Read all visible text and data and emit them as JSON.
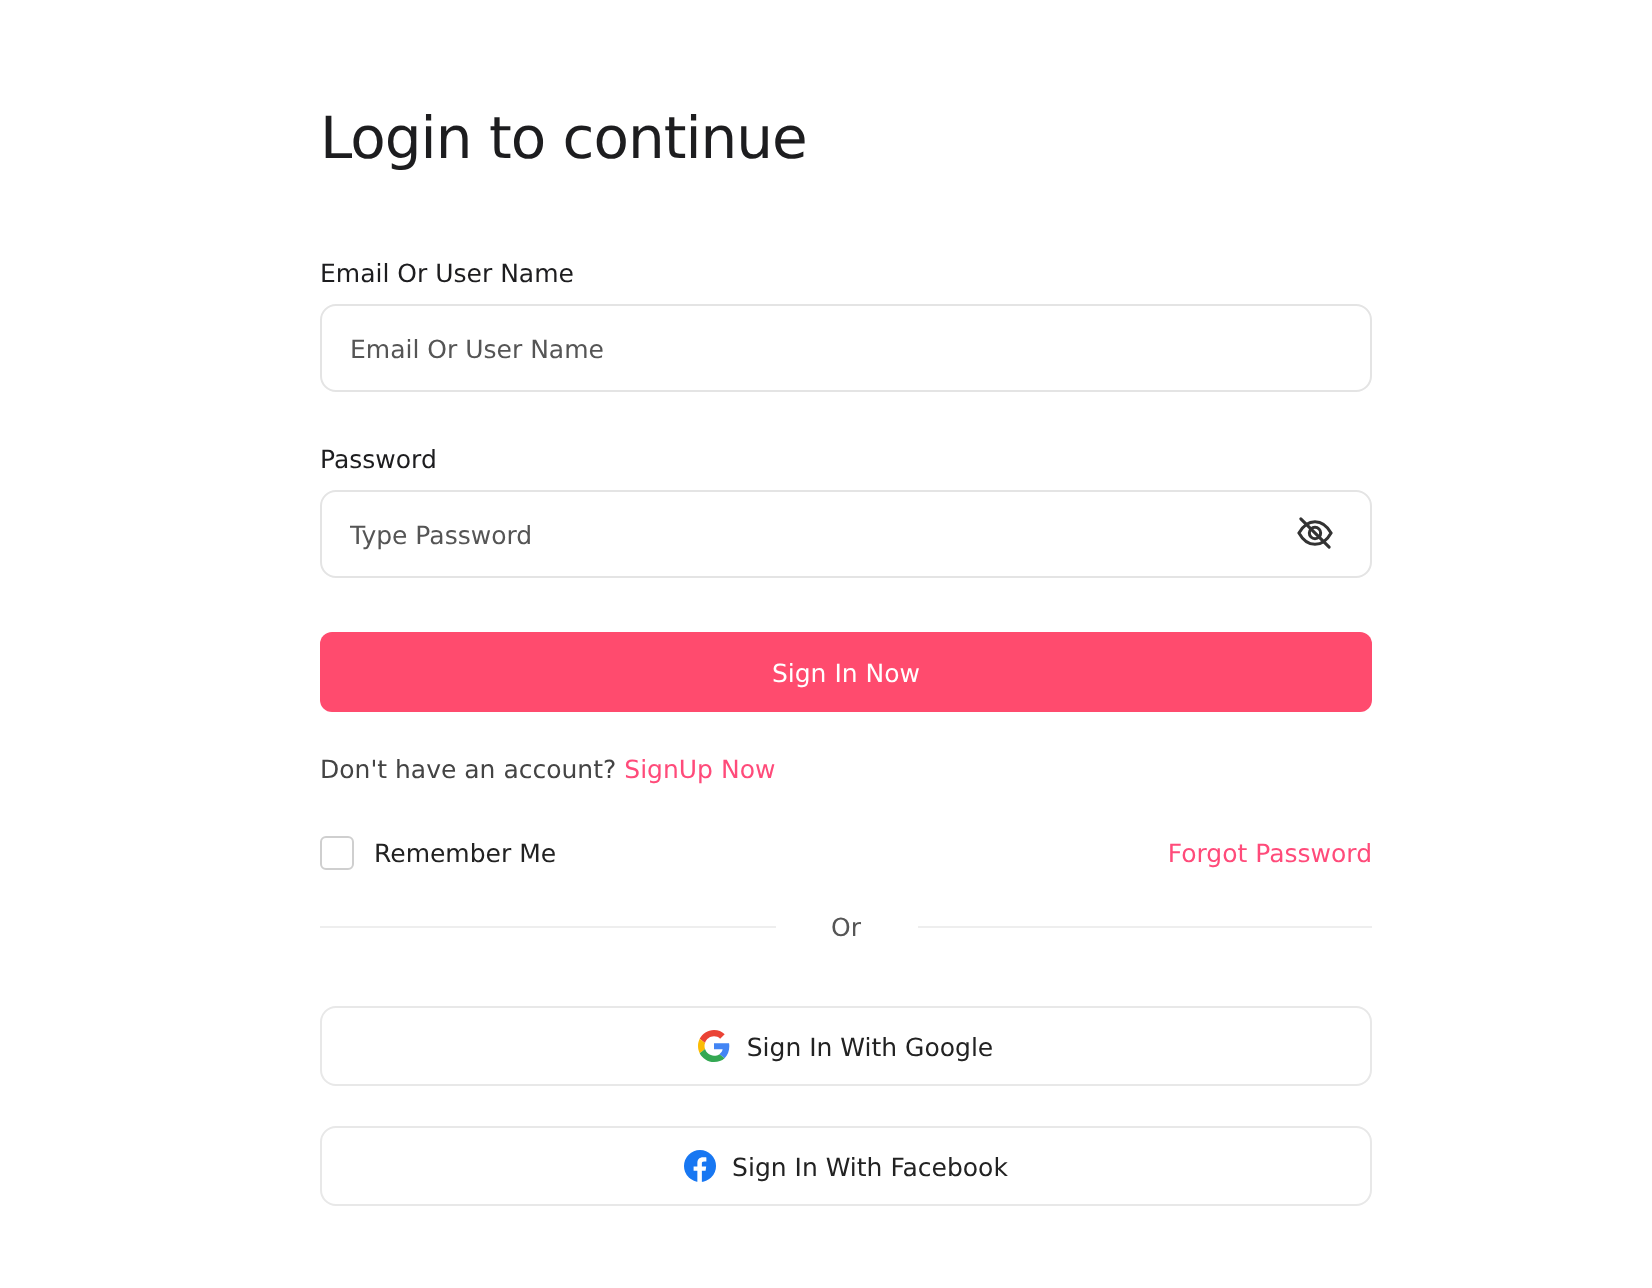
{
  "heading": "Login to continue",
  "fields": [
    {
      "kind": "text",
      "label": "Email Or User Name",
      "placeholder": "Email Or User Name"
    },
    {
      "kind": "password",
      "label": "Password",
      "placeholder": "Type Password",
      "password_visible": false
    }
  ],
  "submit": "Sign In Now",
  "signup": {
    "prompt": "Don't have an account?",
    "link": "SignUp Now"
  },
  "remember": {
    "label": "Remember Me",
    "checked": false
  },
  "forgot": "Forgot Password",
  "divider": "Or",
  "social": [
    {
      "kind": "google",
      "label": "Sign In With Google"
    },
    {
      "kind": "facebook",
      "label": "Sign In With Facebook"
    }
  ]
}
